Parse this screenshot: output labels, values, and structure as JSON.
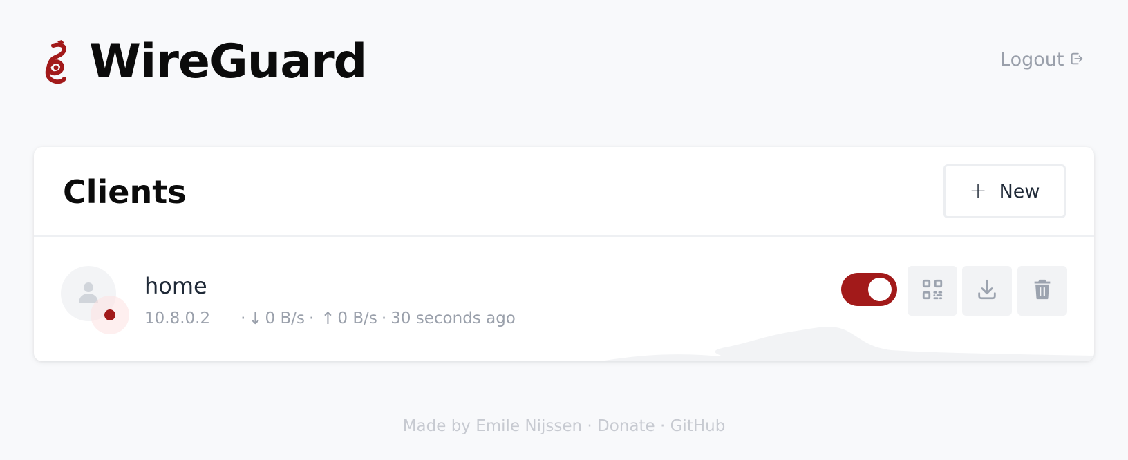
{
  "app": {
    "title": "WireGuard"
  },
  "header": {
    "logout_label": "Logout"
  },
  "clients_card": {
    "title": "Clients",
    "new_button_label": "New",
    "clients": [
      {
        "name": "home",
        "address": "10.8.0.2",
        "separator": "·",
        "download_rate": "0 B/s",
        "upload_rate": "0 B/s",
        "last_handshake": "30 seconds ago",
        "enabled": true,
        "connected": true
      }
    ]
  },
  "footer": {
    "made_by": "Made by Emile Nijssen",
    "separator": "·",
    "donate": "Donate",
    "github": "GitHub"
  },
  "colors": {
    "accent": "#a21a1a",
    "background": "#f8f9fb",
    "muted_text": "#9aa0ab"
  },
  "icons": {
    "logo": "wireguard-dragon-icon",
    "logout": "logout-icon",
    "new": "plus-icon",
    "avatar": "user-icon",
    "qr": "qr-code-icon",
    "download": "download-icon",
    "delete": "trash-icon",
    "down_arrow": "arrow-down-icon",
    "up_arrow": "arrow-up-icon"
  }
}
